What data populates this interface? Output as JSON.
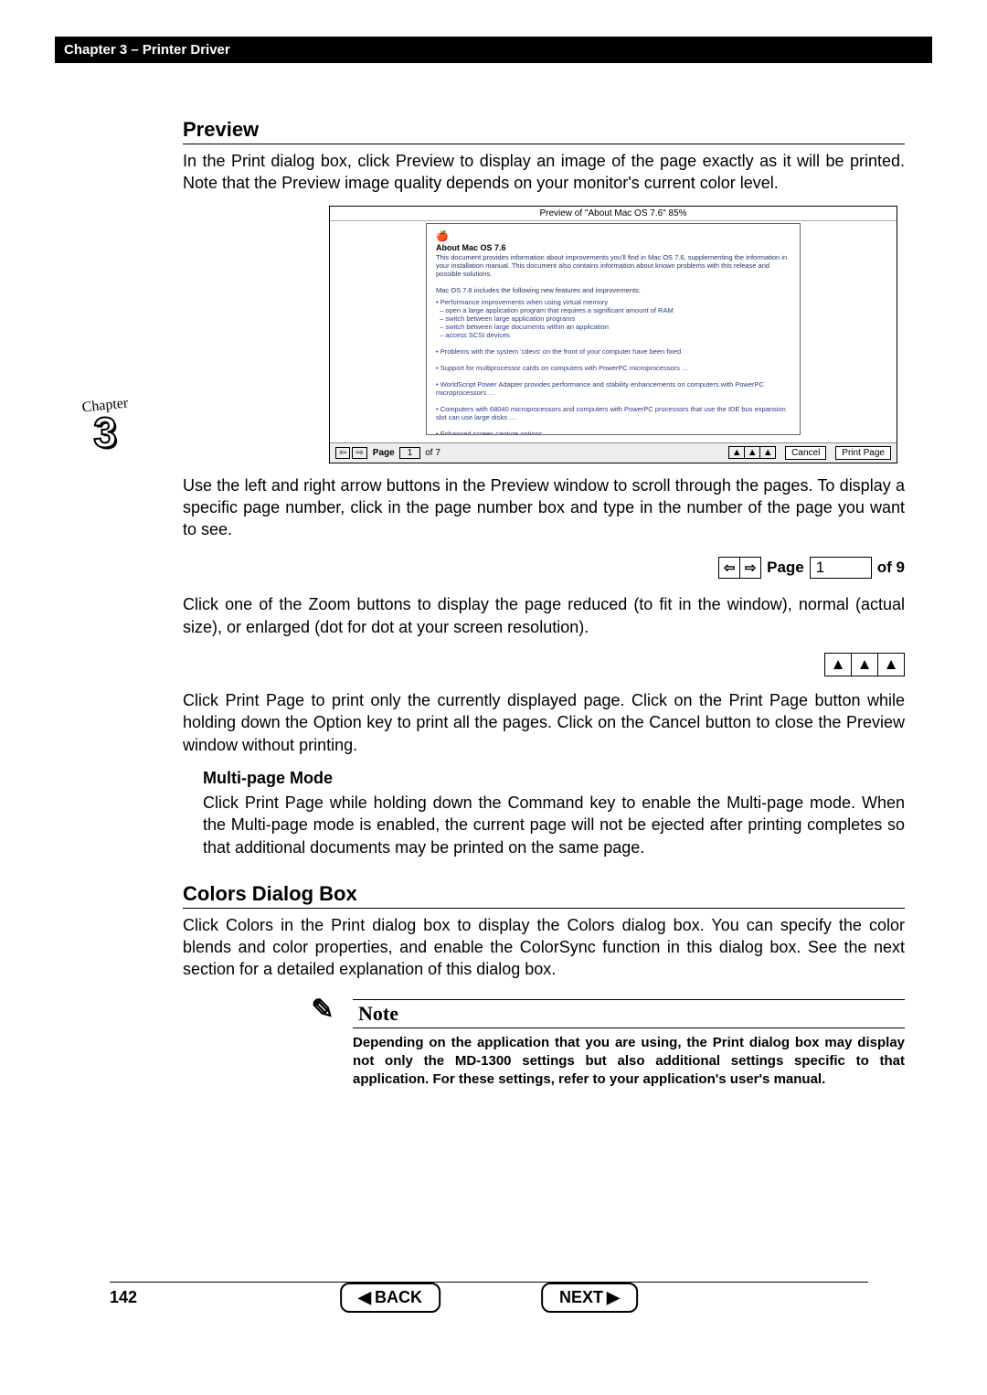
{
  "header": {
    "title": "Chapter 3 – Printer Driver"
  },
  "side_tab": {
    "label": "Chapter",
    "number": "3"
  },
  "sections": {
    "preview": {
      "title": "Preview",
      "p1": "In the Print dialog box, click Preview to display an image of the page exactly as it will be printed.  Note that the Preview image quality depends on your monitor's current color level.",
      "figure": {
        "titlebar": "Preview of \"About Mac OS 7.6\"    85%",
        "heading": "About Mac OS 7.6",
        "blurb1": "This document provides information about improvements you'll find in Mac OS 7.6, supplementing the information in your installation manual. This document also contains information about known problems with this release and possible solutions.",
        "blurb2": "Mac OS 7.6 includes the following new features and improvements:",
        "footer_page_label": "Page",
        "footer_page_value": "1",
        "footer_page_of": "of 7",
        "cancel": "Cancel",
        "print": "Print Page"
      },
      "p2": "Use the left and right arrow buttons in the Preview window to scroll through the pages.  To display a specific page number, click in the page number box and type in the number of the page you want to see.",
      "page_nav": {
        "label": "Page",
        "value": "1",
        "of": "of 9"
      },
      "p3": "Click one of the Zoom buttons to display the page reduced (to fit in the window), normal (actual size), or enlarged (dot for dot at your screen resolution).",
      "p4": "Click Print Page to print only the currently displayed page.  Click on the Print Page button while holding down the Option key to print all the pages.  Click on the Cancel button to close the Preview window without printing.",
      "multipage": {
        "title": "Multi-page Mode",
        "text": "Click Print Page while holding down the Command key to enable the Multi-page mode.  When the Multi-page mode is enabled, the current page will not be ejected after printing completes so that additional documents may be printed on the same page."
      }
    },
    "colors": {
      "title": "Colors Dialog Box",
      "p1": "Click Colors in the Print dialog box to display the Colors dialog box.  You can specify the color blends and color properties, and enable the ColorSync function in this dialog box.  See the next section for a detailed explanation of this dialog box.",
      "note": {
        "label": "Note",
        "text": "Depending on the application that you are using, the Print dialog box may display not only the MD-1300 settings but also additional settings specific to that application.  For these settings, refer to your application's user's manual."
      }
    }
  },
  "footer": {
    "page_number": "142",
    "back": "BACK",
    "next": "NEXT"
  }
}
